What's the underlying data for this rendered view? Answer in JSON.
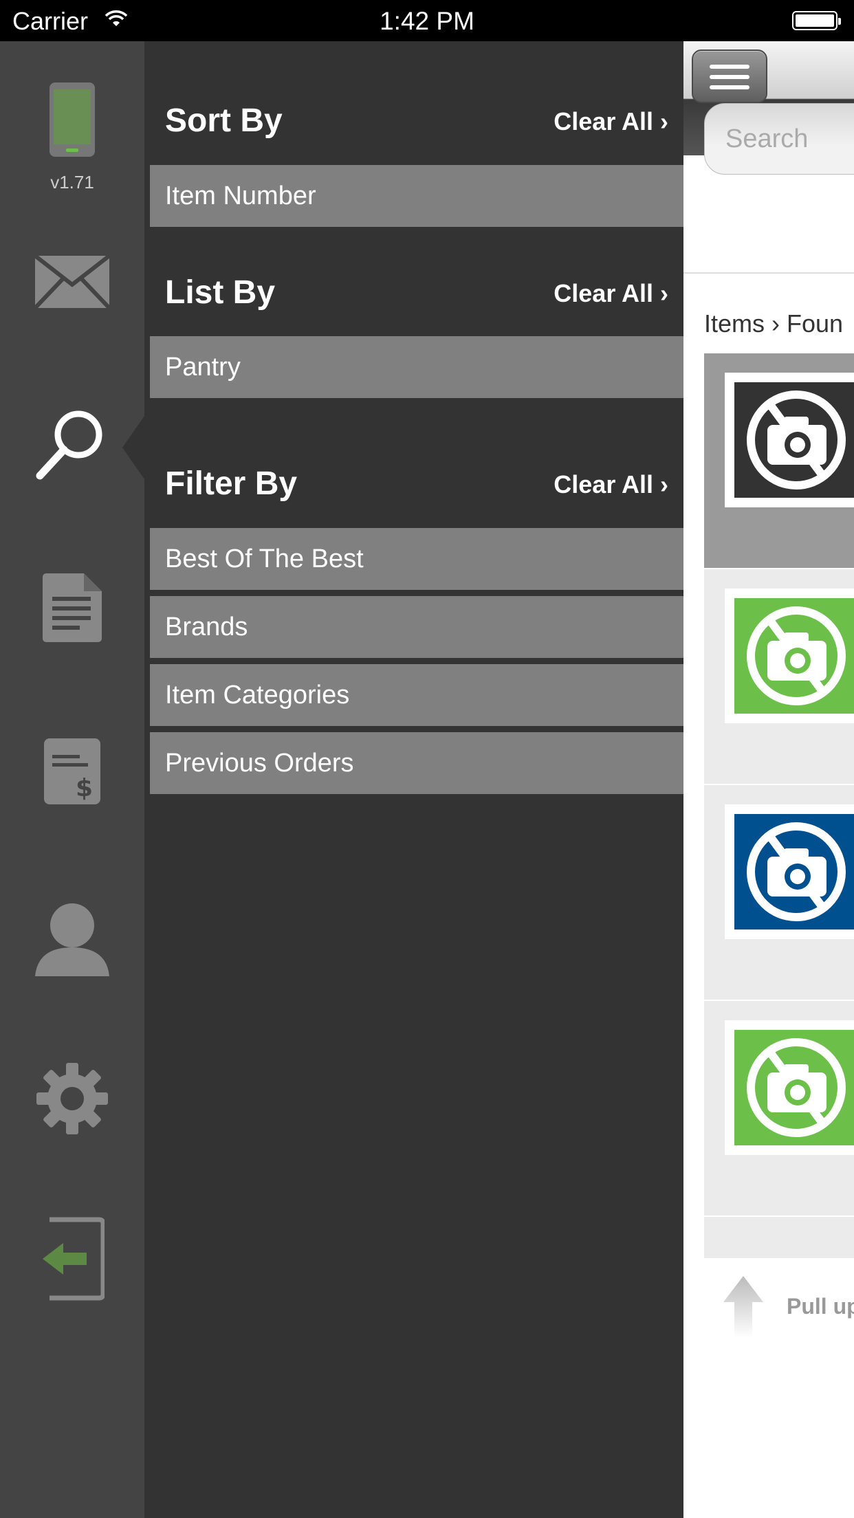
{
  "status_bar": {
    "carrier": "Carrier",
    "time": "1:42 PM"
  },
  "rail": {
    "version": "v1.71",
    "items": [
      {
        "name": "device-icon"
      },
      {
        "name": "mail-icon"
      },
      {
        "name": "search-icon",
        "selected": true
      },
      {
        "name": "document-icon"
      },
      {
        "name": "invoice-icon"
      },
      {
        "name": "user-icon"
      },
      {
        "name": "gear-icon"
      },
      {
        "name": "logout-icon"
      }
    ]
  },
  "panel": {
    "sort": {
      "title": "Sort By",
      "clear": "Clear All ›",
      "items": [
        "Item Number"
      ]
    },
    "list": {
      "title": "List By",
      "clear": "Clear All ›",
      "items": [
        "Pantry"
      ]
    },
    "filter": {
      "title": "Filter By",
      "clear": "Clear All ›",
      "items": [
        "Best Of The Best",
        "Brands",
        "Item Categories",
        "Previous Orders"
      ]
    }
  },
  "main": {
    "search_placeholder": "Search",
    "breadcrumb": "Items › Foun",
    "results": [
      {
        "color": "#333333",
        "selected": true
      },
      {
        "color": "#6cc04a"
      },
      {
        "color": "#004f8f"
      },
      {
        "color": "#6cc04a"
      }
    ],
    "pull_text": "Pull up"
  },
  "colors": {
    "rail": "#444444",
    "panel": "#333333",
    "row": "#808080",
    "accent_green": "#6cc04a"
  }
}
